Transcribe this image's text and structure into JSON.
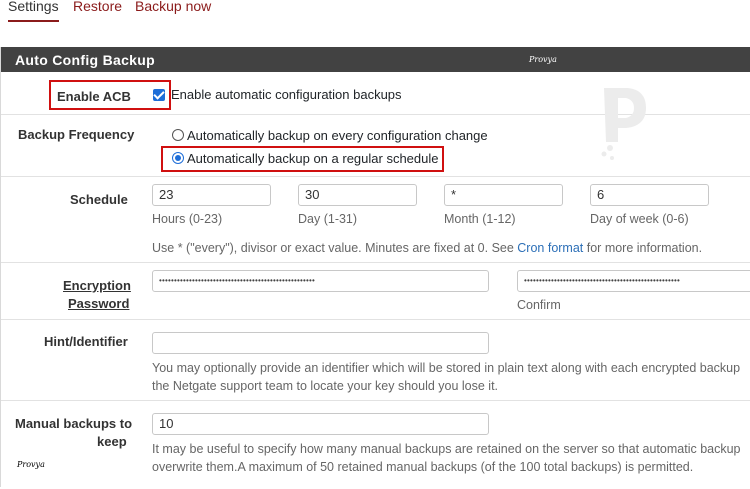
{
  "tabs": [
    "Settings",
    "Restore",
    "Backup now"
  ],
  "panel": {
    "title": "Auto Config Backup",
    "watermark": "Provya"
  },
  "enable": {
    "label": "Enable ACB",
    "checkbox_text": "Enable automatic configuration backups",
    "checked": true
  },
  "frequency": {
    "label": "Backup Frequency",
    "options": [
      "Automatically backup on every configuration change",
      "Automatically backup on a regular schedule"
    ],
    "selected": 1
  },
  "schedule": {
    "label": "Schedule",
    "fields": [
      {
        "value": "23",
        "caption": "Hours (0-23)"
      },
      {
        "value": "30",
        "caption": "Day (1-31)"
      },
      {
        "value": "*",
        "caption": "Month (1-12)"
      },
      {
        "value": "6",
        "caption": "Day of week (0-6)"
      }
    ],
    "help_prefix": "Use * (\"every\"), divisor or exact value. Minutes are fixed at 0. See ",
    "help_link": "Cron format",
    "help_suffix": " for more information."
  },
  "encryption": {
    "label_line1": "Encryption",
    "label_line2": "Password",
    "password_mask": "••••••••••••••••••••••••••••••••••••••••••••••••••••",
    "confirm_mask": "••••••••••••••••••••••••••••••••••••••••••••••••••••",
    "confirm_caption": "Confirm"
  },
  "hint": {
    "label": "Hint/Identifier",
    "value": "",
    "help_line1": "You may optionally provide an identifier which will be stored in plain text along with each encrypted backup",
    "help_line2": "the Netgate support team to locate your key should you lose it."
  },
  "manual": {
    "label_line1": "Manual backups to",
    "label_line2": "keep",
    "value": "10",
    "help_line1": "It may be useful to specify how many manual backups are retained on the server so that automatic backup",
    "help_line2": "overwrite them.A maximum of 50 retained manual backups (of the 100 total backups) is permitted."
  },
  "watermark_bottom": "Provya",
  "colors": {
    "header_bg": "#424242",
    "accent": "#8b1b1b",
    "highlight": "#d01010",
    "control": "#1e6ed8"
  }
}
